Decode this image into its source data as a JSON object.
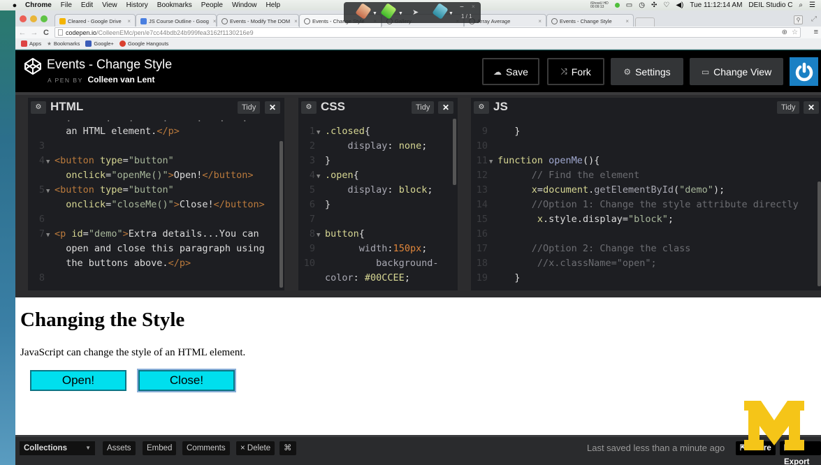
{
  "os_menubar": {
    "app": "Chrome",
    "menus": [
      "File",
      "Edit",
      "View",
      "History",
      "Bookmarks",
      "People",
      "Window",
      "Help"
    ],
    "clock": "Tue 11:12:14 AM",
    "user": "DEIL Studio C",
    "recording_label": "iShowU HD",
    "recording_time": "00:09:13"
  },
  "annotation_toolbar": {
    "page": "1 / 1"
  },
  "browser": {
    "tabs": [
      {
        "label": "Cleared - Google Drive",
        "color": "#f4b400"
      },
      {
        "label": "JS Course Outline - Goog",
        "color": "#4a7fe0"
      },
      {
        "label": "Events - Modify The DOM",
        "color": "#888888"
      },
      {
        "label": "Events - Change Style",
        "color": "#888888",
        "active": true
      },
      {
        "label": "Gallery",
        "color": "#888888"
      },
      {
        "label": "Array Average",
        "color": "#888888"
      },
      {
        "label": "Events - Change Style",
        "color": "#888888"
      }
    ],
    "url_host": "codepen.io",
    "url_path": "/ColleenEMc/pen/e7cc44bdb24b999fea3162f1130216e9",
    "bookmarks": [
      {
        "label": "Apps",
        "color": "#d44"
      },
      {
        "label": "Bookmarks",
        "color": "#777"
      },
      {
        "label": "Google+",
        "color": "#3b5cb8"
      },
      {
        "label": "Google Hangouts",
        "color": "#d9402f"
      }
    ]
  },
  "codepen": {
    "title": "Events - Change Style",
    "byline_prefix": "A PEN BY",
    "author": "Colleen van Lent",
    "buttons": {
      "save": "Save",
      "fork": "Fork",
      "settings": "Settings",
      "change_view": "Change View"
    },
    "accent": "#1a80c4",
    "panels": {
      "html": {
        "title": "HTML",
        "tidy": "Tidy",
        "close": "✕"
      },
      "css": {
        "title": "CSS",
        "tidy": "Tidy",
        "close": "✕"
      },
      "js": {
        "title": "JS",
        "tidy": "Tidy",
        "close": "✕"
      }
    },
    "html_code": {
      "line_partial": "an HTML element.",
      "line_partial_end": "</p>",
      "ln3": "3",
      "ln4": "4",
      "l4a_tag": "<button",
      "l4a_attr": "type",
      "l4a_eq": "=",
      "l4a_str": "\"button\"",
      "l4b_attr": "onclick",
      "l4b_eq": "=",
      "l4b_str": "\"openMe()\"",
      "l4b_gt": ">",
      "l4b_text": "Open!",
      "l4b_close": "</button>",
      "ln5": "5",
      "l5a_tag": "<button",
      "l5a_attr": "type",
      "l5a_str": "\"button\"",
      "l5b_attr": "onclick",
      "l5b_str": "\"closeMe()\"",
      "l5b_text": "Close!",
      "l5b_close": "</button>",
      "ln6": "6",
      "ln7": "7",
      "l7_tag": "<p",
      "l7_attr": "id",
      "l7_str": "\"demo\"",
      "l7_text": "Extra details...You can",
      "l7b_text": "open and close this paragraph using",
      "l7c_text": "the buttons above.",
      "l7c_close": "</p>",
      "ln8": "8"
    },
    "css_code": {
      "lines": [
        {
          "n": "1",
          "sel": ".closed",
          "brace": "{"
        },
        {
          "n": "2",
          "prop": "display",
          "val": "none"
        },
        {
          "n": "3",
          "brace": "}"
        },
        {
          "n": "4",
          "sel": ".open",
          "brace": "{"
        },
        {
          "n": "5",
          "prop": "display",
          "val": "block"
        },
        {
          "n": "6",
          "brace": "}"
        },
        {
          "n": "7"
        },
        {
          "n": "8",
          "sel": "button",
          "brace": "{"
        },
        {
          "n": "9",
          "prop": "width",
          "num": "150px"
        },
        {
          "n": "10",
          "prop": "background-"
        }
      ],
      "wrap_prop": "color",
      "wrap_val": "#00CCEE"
    },
    "js_code": {
      "ln9": "9",
      "l9": "}",
      "ln10": "10",
      "ln11": "11",
      "l11_kw": "function",
      "l11_fn": "openMe",
      "l11_rest": "(){",
      "ln12": "12",
      "l12": "// Find the element",
      "ln13": "13",
      "l13_var": "x",
      "l13_obj": "document",
      "l13_method": "getElementById",
      "l13_str": "\"demo\"",
      "ln14": "14",
      "l14": "//Option 1: Change the style attribute directly",
      "ln15": "15",
      "l15_var": "x",
      "l15_rest": ".style.display=",
      "l15_str": "\"block\"",
      "ln16": "16",
      "ln17": "17",
      "l17": "//Option 2: Change the class",
      "ln18": "18",
      "l18": "//x.className=\"open\";",
      "ln19": "19",
      "l19": "}"
    },
    "preview": {
      "heading": "Changing the Style",
      "paragraph": "JavaScript can change the style of an HTML element.",
      "open_button": "Open!",
      "close_button": "Close!",
      "button_color": "#00DFEE"
    },
    "footer": {
      "collections": "Collections",
      "assets": "Assets",
      "embed": "Embed",
      "comments": "Comments",
      "delete": "× Delete",
      "shortcut": "⌘",
      "saved_status": "Last saved less than a minute ago",
      "share": "Share",
      "export": "Export"
    },
    "watermark": {
      "letter": "M",
      "color": "#f5c518"
    }
  }
}
